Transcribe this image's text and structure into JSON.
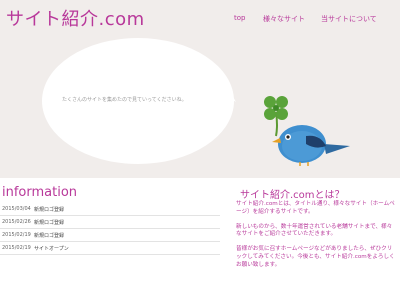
{
  "site": {
    "logo": "サイト紹介.com"
  },
  "nav": [
    {
      "label": "top"
    },
    {
      "label": "様々なサイト"
    },
    {
      "label": "当サイトについて"
    }
  ],
  "hero": {
    "bubble_text": "たくさんのサイトを集めたので見ていってくださいね。"
  },
  "colors": {
    "accent": "#b8389a",
    "hero_bg": "#f1edeb"
  },
  "information": {
    "title": "information",
    "items": [
      {
        "date": "2015/03/04",
        "text": "新規ロゴ登録"
      },
      {
        "date": "2015/02/26",
        "text": "新規ロゴ登録"
      },
      {
        "date": "2015/02/19",
        "text": "新規ロゴ登録"
      },
      {
        "date": "2015/02/19",
        "text": "サイトオープン"
      }
    ]
  },
  "about": {
    "title": "サイト紹介.comとは？",
    "paragraphs": [
      "サイト紹介.comとは、タイトル通り、様々なサイト（ホームページ）を紹介するサイトです。",
      "新しいものから、数十年運営されている老舗サイトまで、様々なサイトをご紹介させていただきます。",
      "皆様がお気に召すホームページなどがありましたら、ぜひクリックしてみてください。今後とも、サイト紹介.comをよろしくお願い致します。"
    ]
  }
}
